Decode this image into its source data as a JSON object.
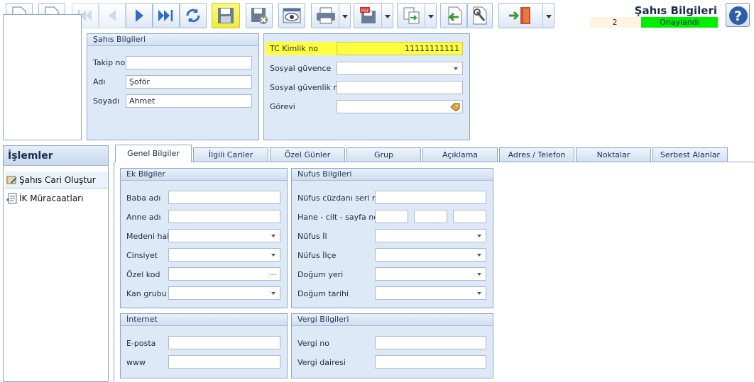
{
  "header": {
    "title": "Şahıs Bilgileri",
    "record_no": "2",
    "status": "Onaylandı",
    "status_color": "#00ee00"
  },
  "toolbar": {
    "icons": [
      "new-document-icon",
      "delete-document-icon",
      "first-record-icon",
      "previous-record-icon",
      "next-record-icon",
      "last-record-icon",
      "refresh-icon",
      "save-icon",
      "save-close-icon",
      "preview-icon",
      "print-icon",
      "pdf-export-icon",
      "copy-icon",
      "undo-back-icon",
      "tools-icon",
      "exit-door-icon",
      "help-icon"
    ],
    "highlight_color": "#f3ef45"
  },
  "person_group": {
    "title": "Şahıs Bilgileri",
    "takip_label": "Takip no",
    "takip_value": "",
    "adi_label": "Adı",
    "adi_value": "Şoför",
    "soyadi_label": "Soyadı",
    "soyadi_value": "Ahmet"
  },
  "id_group": {
    "tc_label": "TC Kimlik no",
    "tc_value": "11111111111",
    "sgk_label": "Sosyal güvence",
    "sgk_value": "",
    "sgk_no_label": "Sosyal güvenlik no",
    "sgk_no_value": "",
    "gorev_label": "Görevi",
    "gorev_value": ""
  },
  "actions": {
    "title": "İşlemler",
    "items": [
      {
        "label": "Şahıs Cari Oluştur"
      },
      {
        "label": "İK Müracaatları"
      }
    ]
  },
  "tabs": [
    "Genel Bilgiler",
    "İlgili Cariler",
    "Özel Günler",
    "Grup",
    "Açıklama",
    "Adres / Telefon",
    "Noktalar",
    "Serbest Alanlar"
  ],
  "ek_bilgiler": {
    "title": "Ek Bilgiler",
    "baba": "Baba adı",
    "anne": "Anne adı",
    "medeni": "Medeni hali",
    "cinsiyet": "Cinsiyet",
    "ozel_kod": "Özel kod",
    "kan": "Kan grubu",
    "ozel_kod_btn": "..."
  },
  "nufus": {
    "title": "Nufus Bilgileri",
    "seri": "Nüfus cüzdanı seri no",
    "hane": "Hane - cilt - sayfa no",
    "il": "Nüfus İl",
    "ilce": "Nüfus İlçe",
    "dogum_yeri": "Doğum yeri",
    "dogum_tarihi": "Doğum tarihi"
  },
  "internet": {
    "title": "İnternet",
    "eposta": "E-posta",
    "www": "www"
  },
  "vergi": {
    "title": "Vergi Bilgileri",
    "no": "Vergi no",
    "daire": "Vergi dairesi"
  }
}
